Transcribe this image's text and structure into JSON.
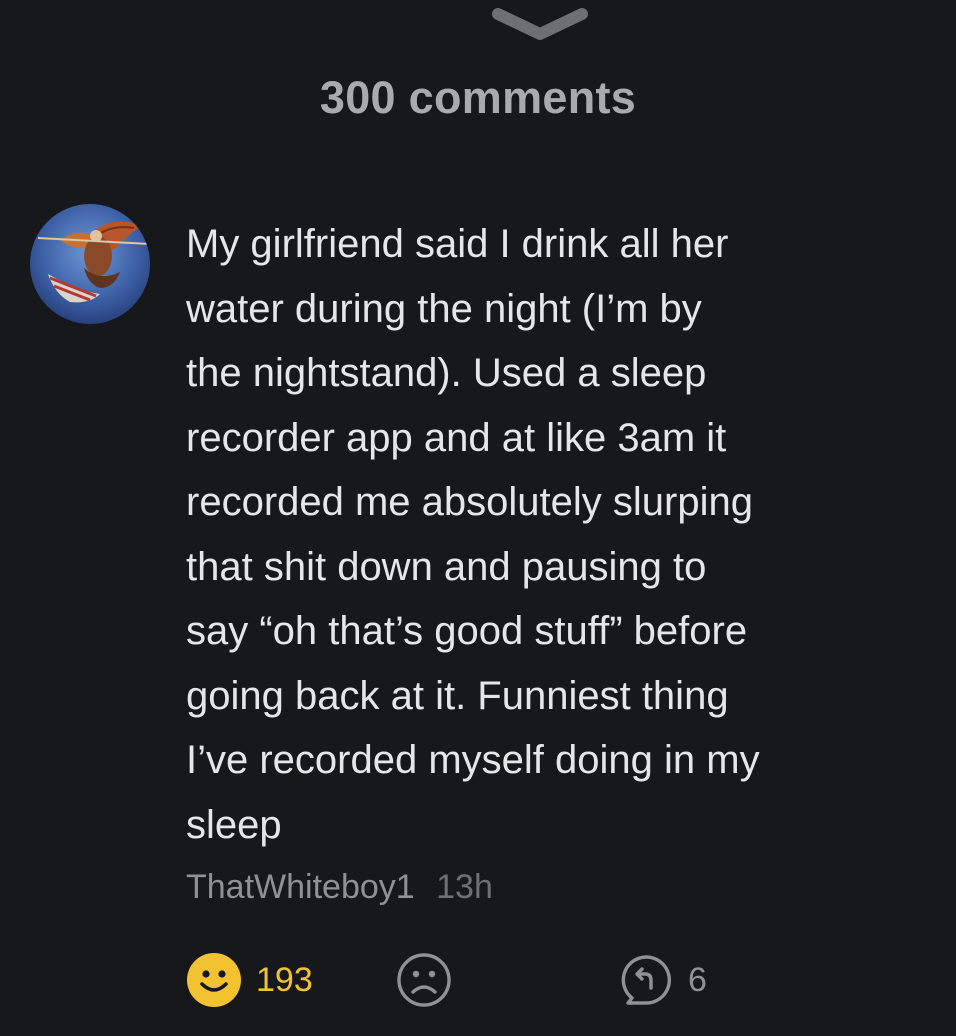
{
  "header": {
    "title": "300 comments"
  },
  "comment": {
    "text": "My girlfriend said I drink all her\nwater during the night (I’m by\nthe nightstand). Used a sleep\nrecorder app and at like 3am it\nrecorded me absolutely slurping\nthat shit down and pausing to\nsay “oh that’s good stuff” before\ngoing back at it. Funniest thing\nI’ve recorded myself doing in my\nsleep",
    "author": "ThatWhiteboy1",
    "time": "13h",
    "likes": "193",
    "replies": "6"
  },
  "icons": {
    "collapse": "chevron-down-icon",
    "like": "smiley-face-icon",
    "dislike": "sad-face-icon",
    "reply": "reply-bubble-icon"
  },
  "colors": {
    "background": "#17181c",
    "text": "#e6e6e8",
    "muted": "#909196",
    "accent": "#f2c230"
  }
}
